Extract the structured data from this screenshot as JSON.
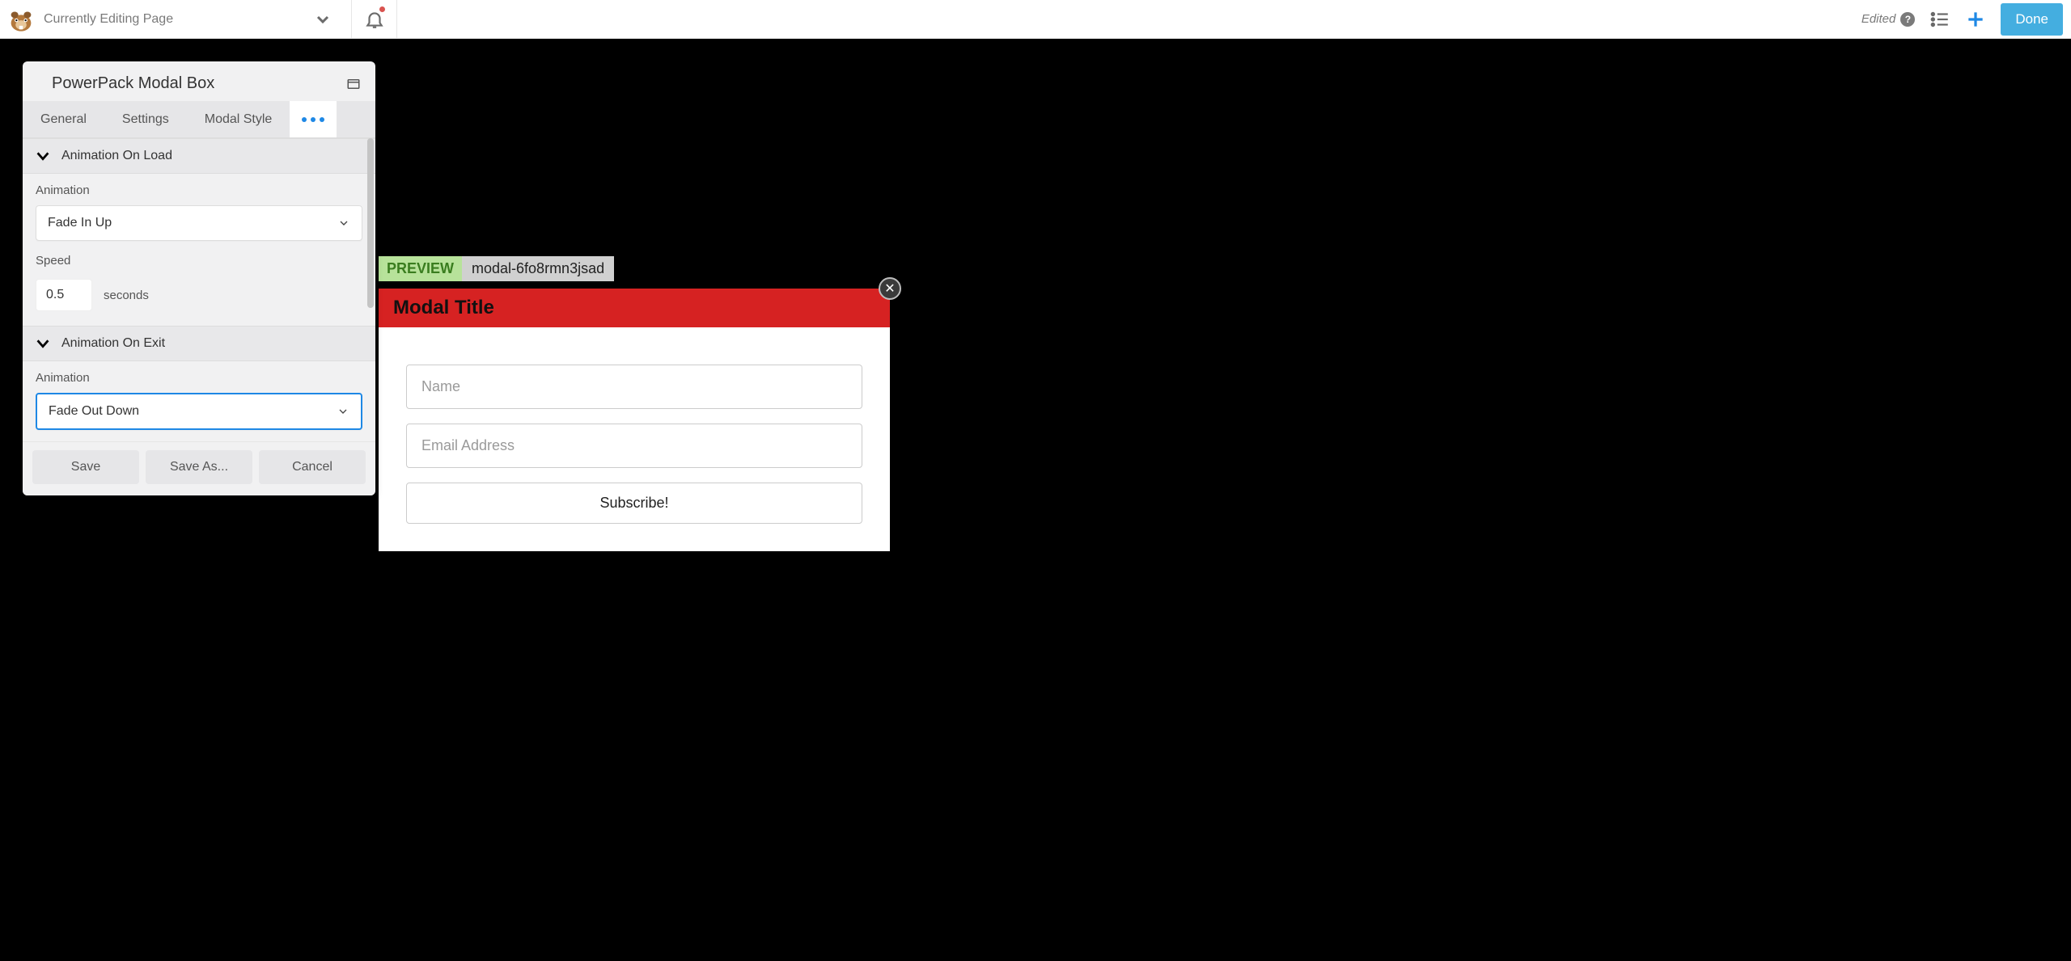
{
  "topbar": {
    "page_title": "Currently Editing Page",
    "edited_label": "Edited",
    "done_label": "Done"
  },
  "panel": {
    "title": "PowerPack Modal Box",
    "tabs": {
      "general": "General",
      "settings": "Settings",
      "modal_style": "Modal Style"
    },
    "sections": {
      "load": {
        "title": "Animation On Load",
        "animation_label": "Animation",
        "animation_value": "Fade In Up",
        "speed_label": "Speed",
        "speed_value": "0.5",
        "speed_unit": "seconds"
      },
      "exit": {
        "title": "Animation On Exit",
        "animation_label": "Animation",
        "animation_value": "Fade Out Down"
      }
    },
    "footer": {
      "save": "Save",
      "save_as": "Save As...",
      "cancel": "Cancel"
    }
  },
  "preview": {
    "badge": "PREVIEW",
    "id": "modal-6fo8rmn3jsad"
  },
  "modal": {
    "title": "Modal Title",
    "name_placeholder": "Name",
    "email_placeholder": "Email Address",
    "subscribe_label": "Subscribe!"
  }
}
